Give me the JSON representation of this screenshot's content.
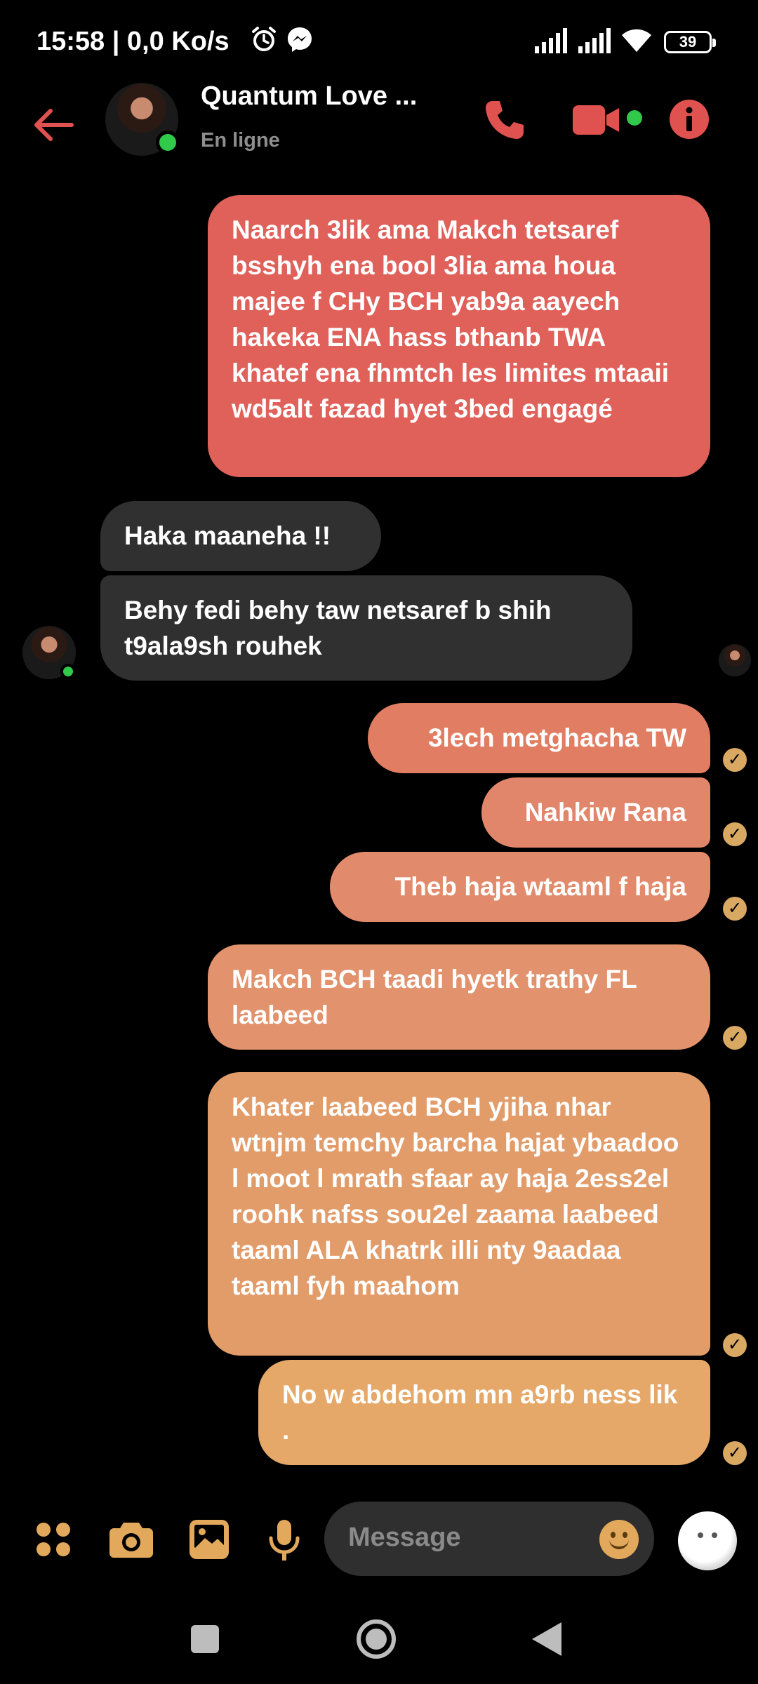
{
  "status_bar": {
    "time": "15:58 | 0,0 Ko/s",
    "battery": "39"
  },
  "header": {
    "contact_name": "Quantum Love ...",
    "contact_status": "En ligne"
  },
  "messages": [
    {
      "direction": "sent",
      "text": "Naarch 3lik ama Makch tetsaref bsshyh ena bool 3lia ama houa majee f CHy BCH yab9a aayech hakeka ENA hass bthanb TWA khatef ena fhmtch les limites mtaaii wd5alt fazad hyet 3bed engagé"
    },
    {
      "direction": "received",
      "text": "Haka maaneha !!"
    },
    {
      "direction": "received",
      "text": "Behy fedi behy taw netsaref b shih t9ala9sh rouhek"
    },
    {
      "direction": "sent",
      "text": "3lech metghacha TW"
    },
    {
      "direction": "sent",
      "text": "Nahkiw Rana"
    },
    {
      "direction": "sent",
      "text": "Theb haja wtaaml f haja"
    },
    {
      "direction": "sent",
      "text": "Makch BCH taadi hyetk trathy FL laabeed"
    },
    {
      "direction": "sent",
      "text": "Khater laabeed BCH yjiha nhar wtnjm temchy barcha hajat ybaadoo l moot l mrath sfaar ay haja 2ess2el roohk nafss sou2el zaama laabeed taaml ALA khatrk illi nty 9aadaa taaml fyh maahom"
    },
    {
      "direction": "sent",
      "text": "No w abdehom mn a9rb ness lik ."
    }
  ],
  "composer": {
    "placeholder": "Message"
  },
  "colors": {
    "accent_red": "#e0524f",
    "gradient_top": "#e0605a",
    "gradient_bottom": "#e6a968",
    "received_bubble": "#303030",
    "online_green": "#31c94a",
    "composer_icon": "#e2a95c"
  },
  "icons": [
    "alarm-icon",
    "messenger-icon",
    "signal-icon",
    "wifi-icon",
    "battery-icon",
    "back-arrow-icon",
    "phone-icon",
    "video-camera-icon",
    "info-icon",
    "apps-grid-icon",
    "camera-icon",
    "gallery-icon",
    "microphone-icon",
    "emoji-icon",
    "sticker-icon",
    "nav-square-icon",
    "nav-home-icon",
    "nav-back-icon"
  ]
}
